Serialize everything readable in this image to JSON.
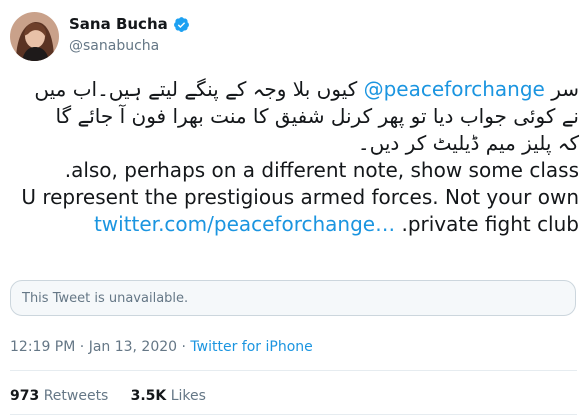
{
  "author": {
    "name": "Sana Bucha",
    "handle": "@sanabucha",
    "verified": true
  },
  "tweet": {
    "line1_pre": "سر",
    "line1_mention": "@peaceforchange",
    "line1_post": "کیوں بلا وجہ کے پنگے لیتے ہیں۔اب میں",
    "line2": "نے کوئی جواب دیا تو پھر کرنل شفیق کا منت بھرا فون آ جائے گا",
    "line3": "کہ پلیز میم ڈیلیٹ کر دیں۔",
    "line4": ".also, perhaps on a different note, show some class",
    "line5": "U represent the prestigious armed forces. Not your own",
    "line6_link": "twitter.com/peaceforchange…",
    "line6_text": ".private fight club"
  },
  "quoted": {
    "unavailable_text": "This Tweet is unavailable."
  },
  "meta": {
    "time": "12:19 PM",
    "separator1": "·",
    "date": "Jan 13, 2020",
    "separator2": "·",
    "via": "Twitter for iPhone"
  },
  "stats": {
    "retweets_count": "973",
    "retweets_label": "Retweets",
    "likes_count": "3.5K",
    "likes_label": "Likes"
  },
  "colors": {
    "link": "#1b95e0",
    "verified": "#1da1f2",
    "muted": "#657786"
  }
}
